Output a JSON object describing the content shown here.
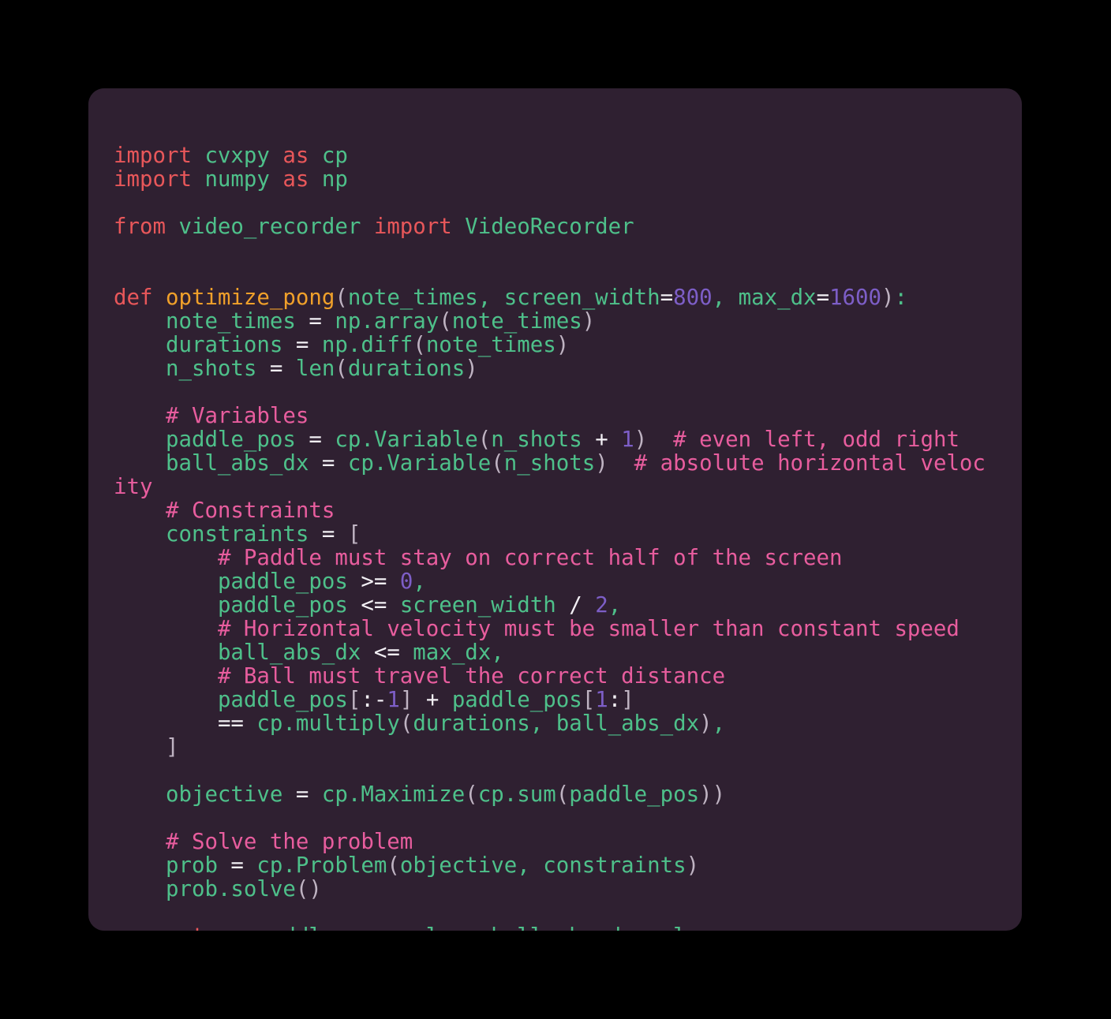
{
  "window": {
    "title": "code-snippet-card",
    "background_color": "#000000",
    "card_background_color": "#2f2031",
    "corner_radius_px": 20
  },
  "theme": {
    "name": "dark-purple-monokai-like",
    "background": "#2f2031",
    "keyword": "#e8575a",
    "function_name": "#f0a02a",
    "identifier": "#4ec08a",
    "number": "#7d5ec7",
    "comment": "#e85d9e",
    "operator": "#f2eff4",
    "bracket": "#bfb3c2"
  },
  "code": {
    "language": "python",
    "font_family": "DejaVu Sans Mono",
    "font_size_px": 27.4,
    "line_height_px": 30,
    "wrap_column": 64,
    "plain_text": "import cvxpy as cp\nimport numpy as np\n\nfrom video_recorder import VideoRecorder\n\n\ndef optimize_pong(note_times, screen_width=800, max_dx=1600):\n    note_times = np.array(note_times)\n    durations = np.diff(note_times)\n    n_shots = len(durations)\n\n    # Variables\n    paddle_pos = cp.Variable(n_shots + 1)  # even left, odd right\n    ball_abs_dx = cp.Variable(n_shots)  # absolute horizontal velocity\n    # Constraints\n    constraints = [\n        # Paddle must stay on correct half of the screen\n        paddle_pos >= 0,\n        paddle_pos <= screen_width / 2,\n        # Horizontal velocity must be smaller than constant speed\n        ball_abs_dx <= max_dx,\n        # Ball must travel the correct distance\n        paddle_pos[:-1] + paddle_pos[1:]\n        == cp.multiply(durations, ball_abs_dx),\n    ]\n\n    objective = cp.Maximize(cp.sum(paddle_pos))\n\n    # Solve the problem\n    prob = cp.Problem(objective, constraints)\n    prob.solve()\n\n    return paddle_pos.value, ball_abs_dx.value",
    "lines": [
      {
        "n": 1,
        "tokens": [
          {
            "t": "kw",
            "s": "import"
          },
          {
            "t": "id",
            "s": " cvxpy "
          },
          {
            "t": "kw",
            "s": "as"
          },
          {
            "t": "id",
            "s": " cp"
          }
        ]
      },
      {
        "n": 2,
        "tokens": [
          {
            "t": "kw",
            "s": "import"
          },
          {
            "t": "id",
            "s": " numpy "
          },
          {
            "t": "kw",
            "s": "as"
          },
          {
            "t": "id",
            "s": " np"
          }
        ]
      },
      {
        "n": 3,
        "tokens": []
      },
      {
        "n": 4,
        "tokens": [
          {
            "t": "kw",
            "s": "from"
          },
          {
            "t": "id",
            "s": " video_recorder "
          },
          {
            "t": "kw",
            "s": "import"
          },
          {
            "t": "id",
            "s": " VideoRecorder"
          }
        ]
      },
      {
        "n": 5,
        "tokens": []
      },
      {
        "n": 6,
        "tokens": []
      },
      {
        "n": 7,
        "tokens": [
          {
            "t": "kw",
            "s": "def"
          },
          {
            "t": "fn",
            "s": " optimize_pong"
          },
          {
            "t": "brk",
            "s": "("
          },
          {
            "t": "id",
            "s": "note_times"
          },
          {
            "t": "pun",
            "s": ", "
          },
          {
            "t": "id",
            "s": "screen_width"
          },
          {
            "t": "op",
            "s": "="
          },
          {
            "t": "num",
            "s": "800"
          },
          {
            "t": "pun",
            "s": ", "
          },
          {
            "t": "id",
            "s": "max_dx"
          },
          {
            "t": "op",
            "s": "="
          },
          {
            "t": "num",
            "s": "1600"
          },
          {
            "t": "brk",
            "s": ")"
          },
          {
            "t": "pun",
            "s": ":"
          }
        ]
      },
      {
        "n": 8,
        "tokens": [
          {
            "t": "id",
            "s": "    note_times "
          },
          {
            "t": "op",
            "s": "="
          },
          {
            "t": "id",
            "s": " np.array"
          },
          {
            "t": "brk",
            "s": "("
          },
          {
            "t": "id",
            "s": "note_times"
          },
          {
            "t": "brk",
            "s": ")"
          }
        ]
      },
      {
        "n": 9,
        "tokens": [
          {
            "t": "id",
            "s": "    durations "
          },
          {
            "t": "op",
            "s": "="
          },
          {
            "t": "id",
            "s": " np.diff"
          },
          {
            "t": "brk",
            "s": "("
          },
          {
            "t": "id",
            "s": "note_times"
          },
          {
            "t": "brk",
            "s": ")"
          }
        ]
      },
      {
        "n": 10,
        "tokens": [
          {
            "t": "id",
            "s": "    n_shots "
          },
          {
            "t": "op",
            "s": "="
          },
          {
            "t": "id",
            "s": " len"
          },
          {
            "t": "brk",
            "s": "("
          },
          {
            "t": "id",
            "s": "durations"
          },
          {
            "t": "brk",
            "s": ")"
          }
        ]
      },
      {
        "n": 11,
        "tokens": []
      },
      {
        "n": 12,
        "tokens": [
          {
            "t": "com",
            "s": "    # Variables"
          }
        ]
      },
      {
        "n": 13,
        "tokens": [
          {
            "t": "id",
            "s": "    paddle_pos "
          },
          {
            "t": "op",
            "s": "="
          },
          {
            "t": "id",
            "s": " cp.Variable"
          },
          {
            "t": "brk",
            "s": "("
          },
          {
            "t": "id",
            "s": "n_shots "
          },
          {
            "t": "op",
            "s": "+"
          },
          {
            "t": "num",
            "s": " 1"
          },
          {
            "t": "brk",
            "s": ")"
          },
          {
            "t": "com",
            "s": "  # even left, odd right"
          }
        ]
      },
      {
        "n": 14,
        "tokens": [
          {
            "t": "id",
            "s": "    ball_abs_dx "
          },
          {
            "t": "op",
            "s": "="
          },
          {
            "t": "id",
            "s": " cp.Variable"
          },
          {
            "t": "brk",
            "s": "("
          },
          {
            "t": "id",
            "s": "n_shots"
          },
          {
            "t": "brk",
            "s": ")"
          },
          {
            "t": "com",
            "s": "  # absolute horizontal velocity"
          }
        ]
      },
      {
        "n": 15,
        "tokens": [
          {
            "t": "com",
            "s": "    # Constraints"
          }
        ]
      },
      {
        "n": 16,
        "tokens": [
          {
            "t": "id",
            "s": "    constraints "
          },
          {
            "t": "op",
            "s": "="
          },
          {
            "t": "brk",
            "s": " ["
          }
        ]
      },
      {
        "n": 17,
        "tokens": [
          {
            "t": "com",
            "s": "        # Paddle must stay on correct half of the screen"
          }
        ]
      },
      {
        "n": 18,
        "tokens": [
          {
            "t": "id",
            "s": "        paddle_pos "
          },
          {
            "t": "op",
            "s": ">="
          },
          {
            "t": "num",
            "s": " 0"
          },
          {
            "t": "pun",
            "s": ","
          }
        ]
      },
      {
        "n": 19,
        "tokens": [
          {
            "t": "id",
            "s": "        paddle_pos "
          },
          {
            "t": "op",
            "s": "<="
          },
          {
            "t": "id",
            "s": " screen_width "
          },
          {
            "t": "op",
            "s": "/"
          },
          {
            "t": "num",
            "s": " 2"
          },
          {
            "t": "pun",
            "s": ","
          }
        ]
      },
      {
        "n": 20,
        "tokens": [
          {
            "t": "com",
            "s": "        # Horizontal velocity must be smaller than constant speed"
          }
        ]
      },
      {
        "n": 21,
        "tokens": [
          {
            "t": "id",
            "s": "        ball_abs_dx "
          },
          {
            "t": "op",
            "s": "<="
          },
          {
            "t": "id",
            "s": " max_dx"
          },
          {
            "t": "pun",
            "s": ","
          }
        ]
      },
      {
        "n": 22,
        "tokens": [
          {
            "t": "com",
            "s": "        # Ball must travel the correct distance"
          }
        ]
      },
      {
        "n": 23,
        "tokens": [
          {
            "t": "id",
            "s": "        paddle_pos"
          },
          {
            "t": "brk",
            "s": "["
          },
          {
            "t": "op",
            "s": ":-"
          },
          {
            "t": "num",
            "s": "1"
          },
          {
            "t": "brk",
            "s": "]"
          },
          {
            "t": "op",
            "s": " + "
          },
          {
            "t": "id",
            "s": "paddle_pos"
          },
          {
            "t": "brk",
            "s": "["
          },
          {
            "t": "num",
            "s": "1"
          },
          {
            "t": "op",
            "s": ":"
          },
          {
            "t": "brk",
            "s": "]"
          }
        ]
      },
      {
        "n": 24,
        "tokens": [
          {
            "t": "op",
            "s": "        =="
          },
          {
            "t": "id",
            "s": " cp.multiply"
          },
          {
            "t": "brk",
            "s": "("
          },
          {
            "t": "id",
            "s": "durations"
          },
          {
            "t": "pun",
            "s": ", "
          },
          {
            "t": "id",
            "s": "ball_abs_dx"
          },
          {
            "t": "brk",
            "s": ")"
          },
          {
            "t": "pun",
            "s": ","
          }
        ]
      },
      {
        "n": 25,
        "tokens": [
          {
            "t": "brk",
            "s": "    ]"
          }
        ]
      },
      {
        "n": 26,
        "tokens": []
      },
      {
        "n": 27,
        "tokens": [
          {
            "t": "id",
            "s": "    objective "
          },
          {
            "t": "op",
            "s": "="
          },
          {
            "t": "id",
            "s": " cp.Maximize"
          },
          {
            "t": "brk",
            "s": "("
          },
          {
            "t": "id",
            "s": "cp.sum"
          },
          {
            "t": "brk",
            "s": "("
          },
          {
            "t": "id",
            "s": "paddle_pos"
          },
          {
            "t": "brk",
            "s": "))"
          }
        ]
      },
      {
        "n": 28,
        "tokens": []
      },
      {
        "n": 29,
        "tokens": [
          {
            "t": "com",
            "s": "    # Solve the problem"
          }
        ]
      },
      {
        "n": 30,
        "tokens": [
          {
            "t": "id",
            "s": "    prob "
          },
          {
            "t": "op",
            "s": "="
          },
          {
            "t": "id",
            "s": " cp.Problem"
          },
          {
            "t": "brk",
            "s": "("
          },
          {
            "t": "id",
            "s": "objective"
          },
          {
            "t": "pun",
            "s": ", "
          },
          {
            "t": "id",
            "s": "constraints"
          },
          {
            "t": "brk",
            "s": ")"
          }
        ]
      },
      {
        "n": 31,
        "tokens": [
          {
            "t": "id",
            "s": "    prob.solve"
          },
          {
            "t": "brk",
            "s": "()"
          }
        ]
      },
      {
        "n": 32,
        "tokens": []
      },
      {
        "n": 33,
        "tokens": [
          {
            "t": "kw",
            "s": "    return"
          },
          {
            "t": "id",
            "s": " paddle_pos.value"
          },
          {
            "t": "pun",
            "s": ", "
          },
          {
            "t": "id",
            "s": "ball_abs_dx.value"
          }
        ]
      }
    ]
  }
}
